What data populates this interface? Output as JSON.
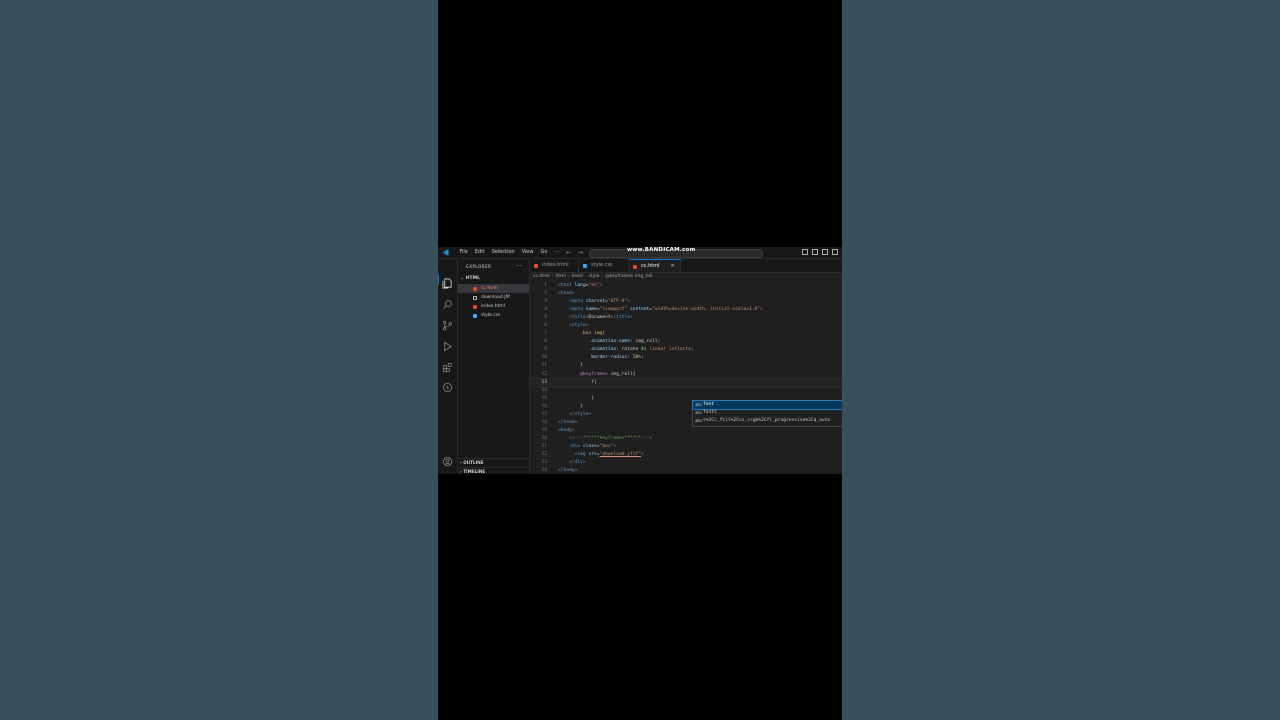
{
  "watermark": "www.BANDICAM.com",
  "menu": [
    "File",
    "Edit",
    "Selection",
    "View",
    "Go",
    "···"
  ],
  "nav": {
    "back": "←",
    "forward": "→"
  },
  "sidebar": {
    "title": "EXPLORER",
    "more": "···",
    "folder": "HTML",
    "files": [
      {
        "name": "cc.html",
        "type": "html",
        "active": true
      },
      {
        "name": "download.jfif",
        "type": "img",
        "active": false
      },
      {
        "name": "index.html",
        "type": "html",
        "active": false
      },
      {
        "name": "style.css",
        "type": "css",
        "active": false
      }
    ],
    "outline": "OUTLINE",
    "timeline": "TIMELINE"
  },
  "tabs": [
    {
      "label": "index.html",
      "type": "html",
      "active": false
    },
    {
      "label": "style.css",
      "type": "css",
      "active": false
    },
    {
      "label": "cc.html",
      "type": "html",
      "active": true
    }
  ],
  "tab_close": "×",
  "breadcrumb": [
    "cc.html",
    "html",
    "head",
    "style",
    "@keyframes img_roll"
  ],
  "lines": [
    {
      "n": "1"
    },
    {
      "n": "2"
    },
    {
      "n": "3"
    },
    {
      "n": "4"
    },
    {
      "n": "5"
    },
    {
      "n": "6"
    },
    {
      "n": "7"
    },
    {
      "n": "8"
    },
    {
      "n": "9"
    },
    {
      "n": "10"
    },
    {
      "n": "11"
    },
    {
      "n": "12"
    },
    {
      "n": "13"
    },
    {
      "n": "14"
    },
    {
      "n": "15"
    },
    {
      "n": "16"
    },
    {
      "n": "17"
    },
    {
      "n": "18"
    },
    {
      "n": "19"
    },
    {
      "n": "20"
    },
    {
      "n": "21"
    },
    {
      "n": "22"
    },
    {
      "n": "23"
    },
    {
      "n": "24"
    }
  ],
  "suggest": {
    "items": [
      {
        "icon": "abc",
        "label": "font"
      },
      {
        "icon": "abc",
        "label": "fonts"
      },
      {
        "icon": "abc",
        "label": "s%2Cc_fill%2Ccs_srgb%2Cfl_progressive%2Cq_auto"
      }
    ]
  },
  "colors": {
    "accent": "#0078d4",
    "background": "#3a4f5c"
  }
}
